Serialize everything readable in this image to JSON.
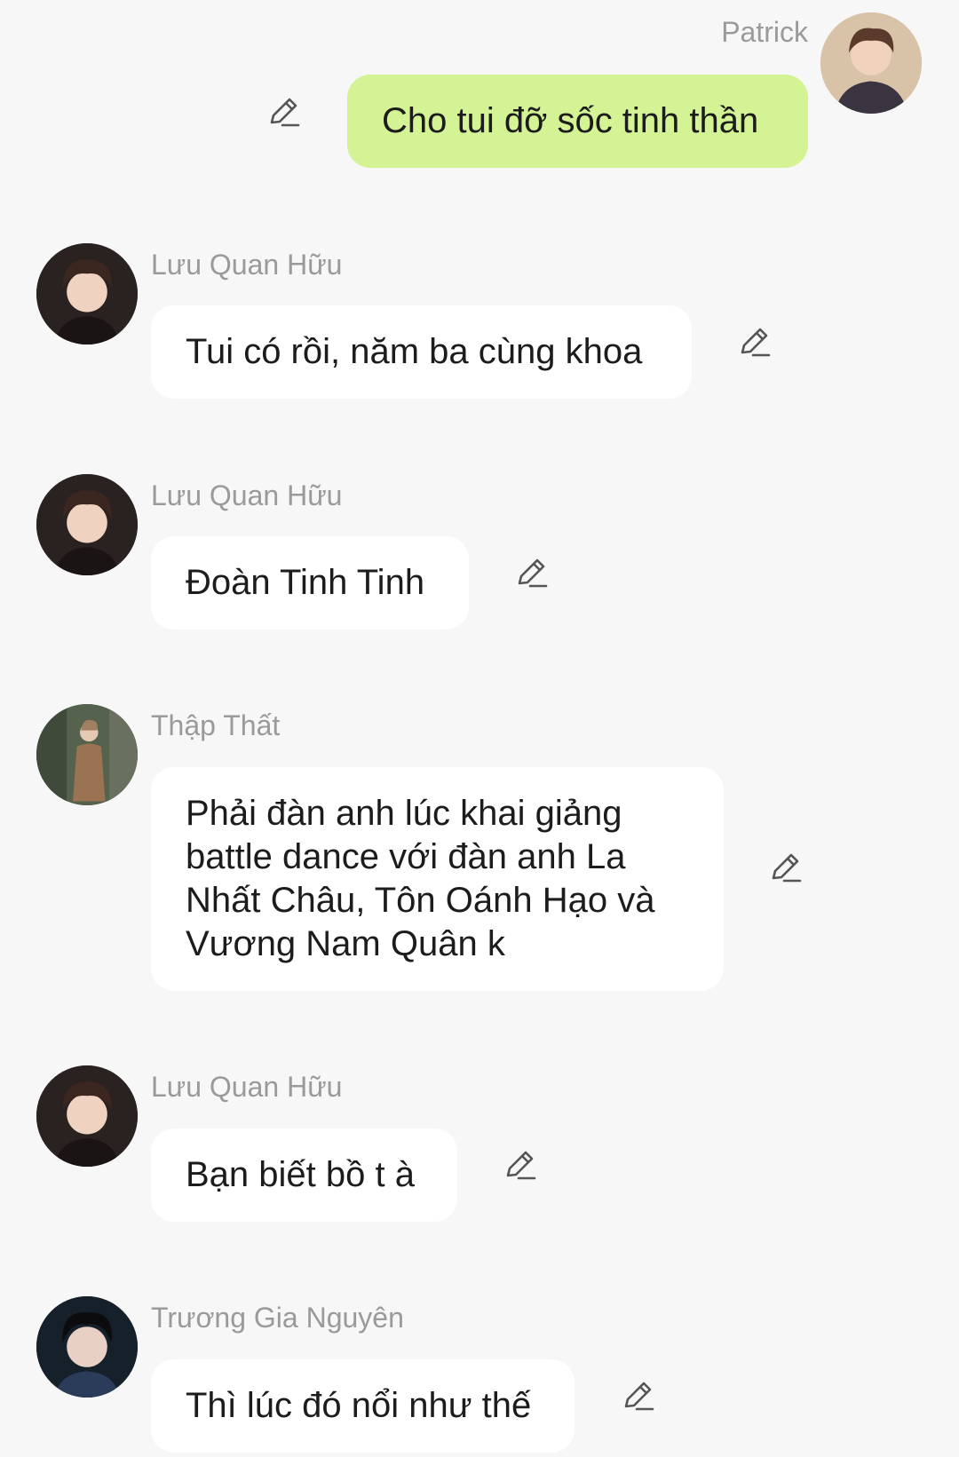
{
  "messages": [
    {
      "sender": "Patrick",
      "text": "Cho tui đỡ sốc tinh thần",
      "direction": "outgoing"
    },
    {
      "sender": "Lưu Quan Hữu",
      "text": "Tui có rồi, năm ba cùng khoa",
      "direction": "incoming"
    },
    {
      "sender": "Lưu Quan Hữu",
      "text": "Đoàn Tinh Tinh",
      "direction": "incoming"
    },
    {
      "sender": "Thập Thất",
      "text": "Phải đàn anh lúc khai giảng battle dance với đàn anh La Nhất Châu, Tôn Oánh Hạo và Vương Nam Quân k",
      "direction": "incoming"
    },
    {
      "sender": "Lưu Quan Hữu",
      "text": "Bạn biết bồ t à",
      "direction": "incoming"
    },
    {
      "sender": "Trương Gia Nguyên",
      "text": "Thì lúc đó nổi như thế",
      "direction": "incoming"
    }
  ],
  "icons": {
    "edit": "pencil-edit-icon",
    "avatar": "profile-photo"
  },
  "colors": {
    "background": "#f7f7f7",
    "outgoing_bubble": "#d4f395",
    "incoming_bubble": "#ffffff",
    "sender_name": "#9a9a9a",
    "message_text": "#1c1c1c"
  }
}
